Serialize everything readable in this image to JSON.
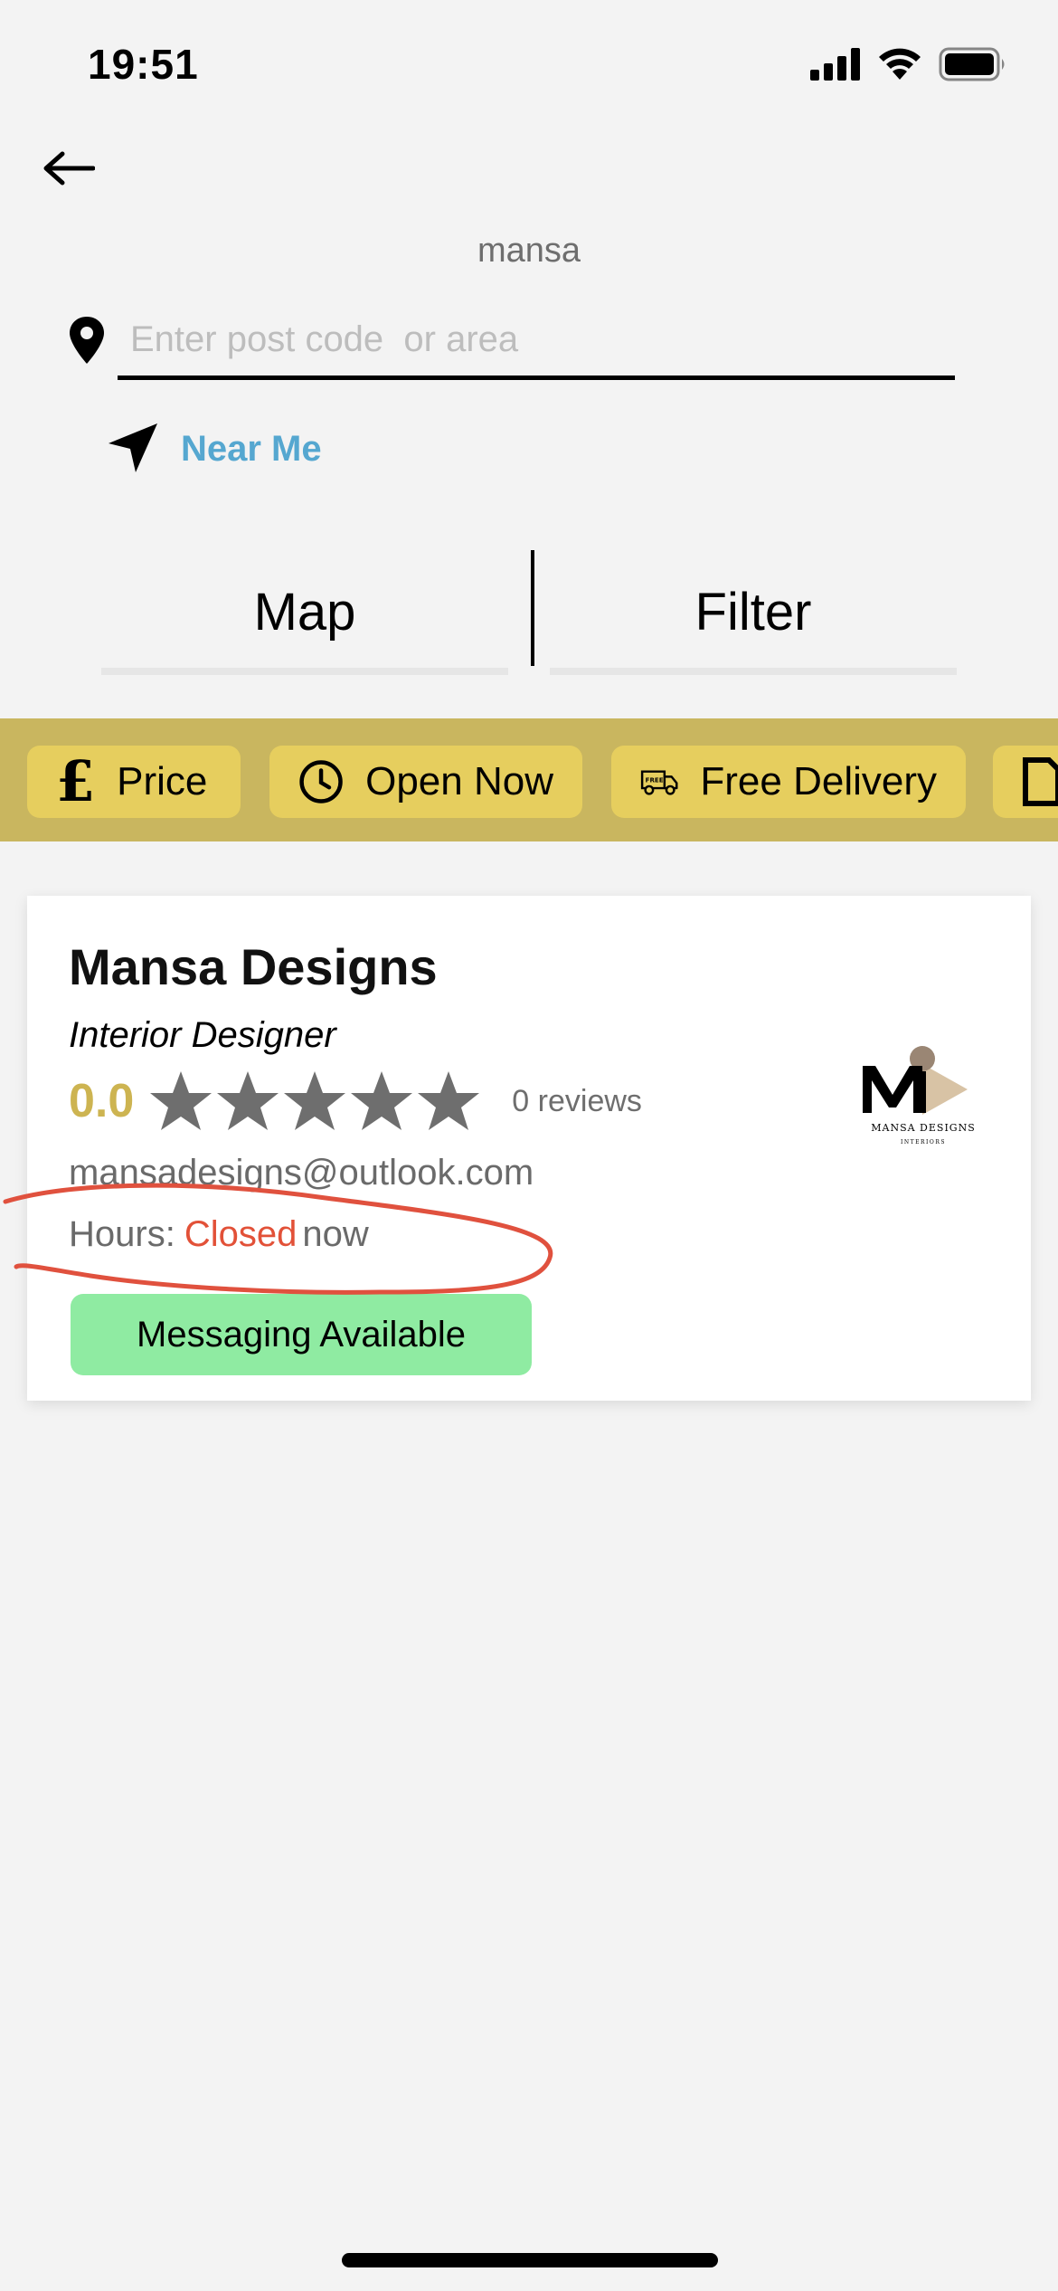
{
  "status_bar": {
    "time": "19:51"
  },
  "search": {
    "title": "mansa",
    "placeholder": "Enter post code  or area",
    "near_me_label": "Near Me"
  },
  "tabs": {
    "map": "Map",
    "filter": "Filter"
  },
  "chips": [
    {
      "label": "Price",
      "icon": "pound-icon"
    },
    {
      "label": "Open Now",
      "icon": "clock-icon"
    },
    {
      "label": "Free Delivery",
      "icon": "delivery-truck-icon"
    }
  ],
  "listing": {
    "name": "Mansa Designs",
    "category": "Interior Designer",
    "rating": "0.0",
    "stars_filled": 0,
    "stars_total": 5,
    "reviews": "0 reviews",
    "email": "mansadesigns@outlook.com",
    "hours_label": "Hours:",
    "hours_status": "Closed",
    "hours_suffix": "now",
    "messaging_label": "Messaging Available",
    "logo_text": "MANSA DESIGNS",
    "logo_subtext": "INTERIORS"
  },
  "colors": {
    "chip_bar": "#c9b65f",
    "chip": "#e6ce5e",
    "near_me": "#55a7d0",
    "rating": "#cdb451",
    "closed": "#e25138",
    "messaging": "#8feba2",
    "annotation": "#e0513e"
  }
}
